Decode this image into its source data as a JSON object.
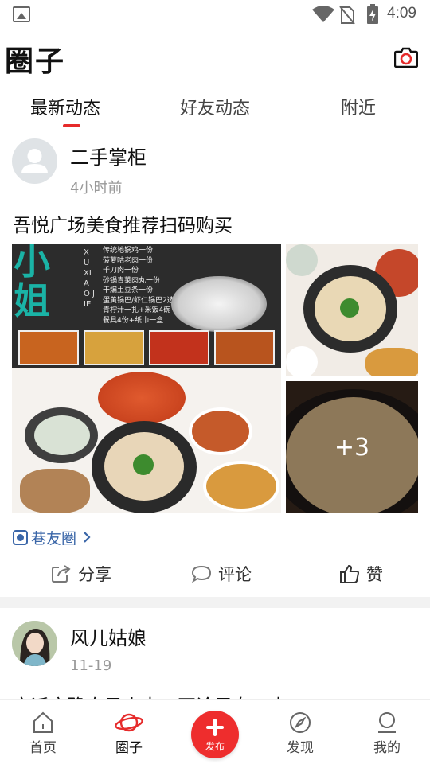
{
  "status_bar": {
    "time": "4:09"
  },
  "header": {
    "title": "圈子"
  },
  "tabs": [
    {
      "label": "最新动态",
      "active": true
    },
    {
      "label": "好友动态",
      "active": false
    },
    {
      "label": "附近",
      "active": false
    }
  ],
  "posts": [
    {
      "author": "二手掌柜",
      "time": "4小时前",
      "text": "吾悦广场美食推荐扫码购买",
      "more_images": "+3",
      "circle_tag": "巷友圈",
      "menu_overlay": {
        "big_chars": "小姐",
        "pinyin": "XU XIAO JIE",
        "items": [
          "传统地锅鸡一份",
          "菠萝咕老肉一份",
          "千刀肉一份",
          "砂锅青菜肉丸一份",
          "干煸土豆条一份",
          "蛋黄锅巴/虾仁锅巴2选1",
          "青柠汁一扎+米饭4碗",
          "餐具4份+纸巾一盒"
        ]
      }
    },
    {
      "author": "风儿姑娘",
      "time": "11-19",
      "text": "完迁宿豫自己人士，不论男女一大"
    }
  ],
  "actions": {
    "share": "分享",
    "comment": "评论",
    "like": "赞"
  },
  "bottom_nav": [
    {
      "label": "首页",
      "icon": "home-icon"
    },
    {
      "label": "圈子",
      "icon": "planet-icon",
      "active": true
    },
    {
      "label": "发布",
      "icon": "plus-icon"
    },
    {
      "label": "发现",
      "icon": "compass-icon"
    },
    {
      "label": "我的",
      "icon": "user-icon"
    }
  ],
  "colors": {
    "accent": "#e62b2b",
    "link": "#3a66a8"
  }
}
